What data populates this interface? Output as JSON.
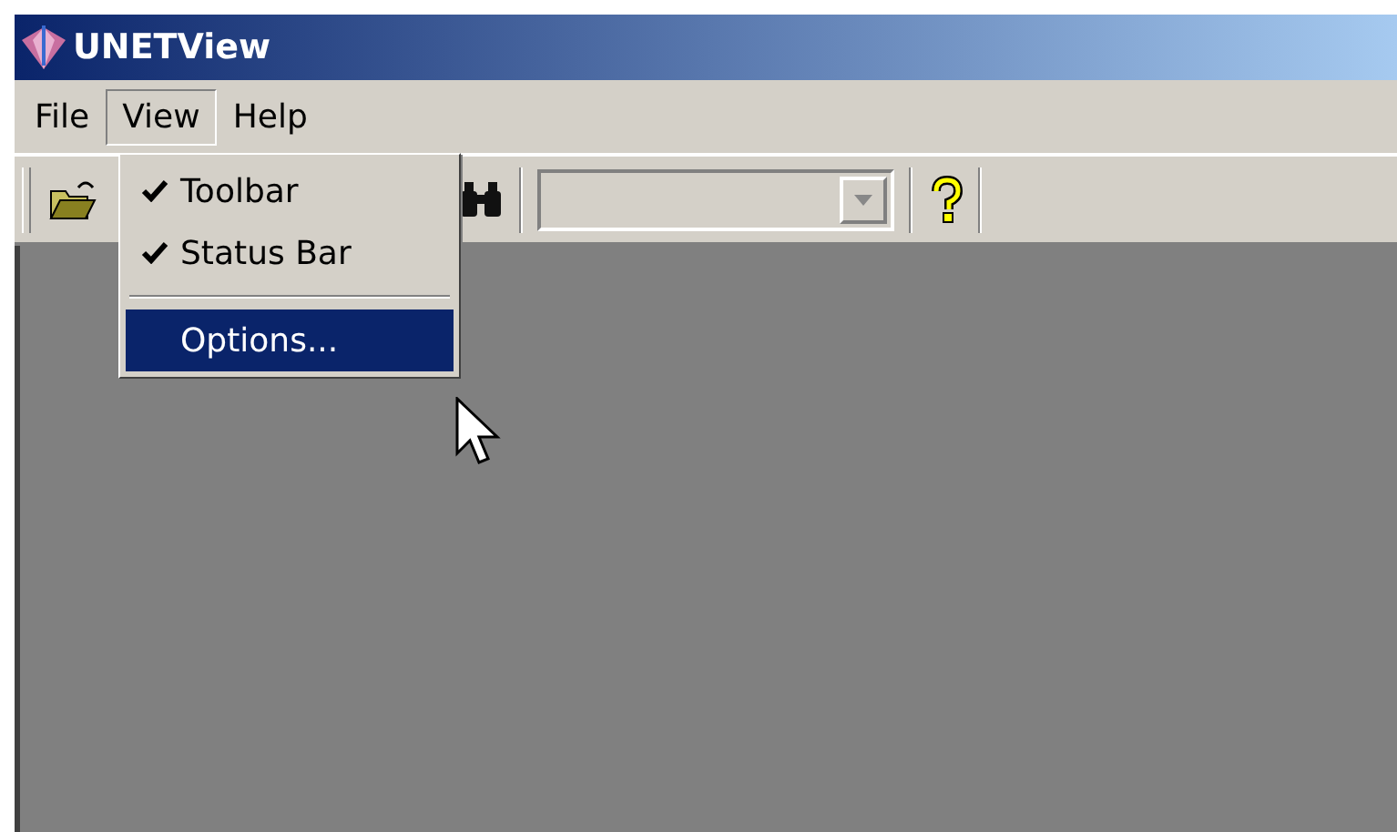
{
  "window": {
    "title": "UNETView"
  },
  "menu": [
    {
      "label": "File",
      "selected": false
    },
    {
      "label": "View",
      "selected": true
    },
    {
      "label": "Help",
      "selected": false
    }
  ],
  "dropdown": [
    {
      "kind": "item",
      "label": "Toolbar",
      "checked": true,
      "selected": false
    },
    {
      "kind": "item",
      "label": "Status Bar",
      "checked": true,
      "selected": false
    },
    {
      "kind": "separator"
    },
    {
      "kind": "item",
      "label": "Options...",
      "checked": false,
      "selected": true
    }
  ]
}
